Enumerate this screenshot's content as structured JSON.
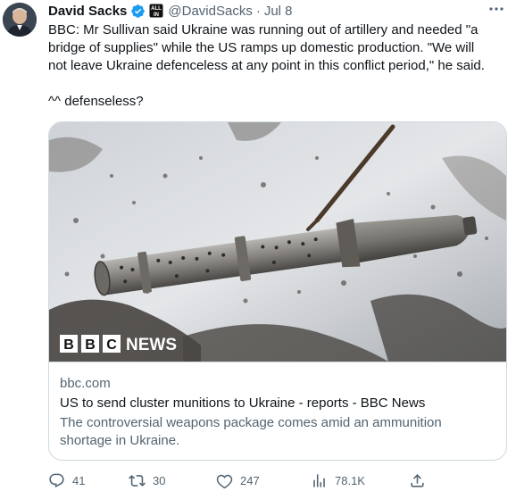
{
  "tweet": {
    "author_name": "David Sacks",
    "handle": "@DavidSacks",
    "separator": "·",
    "date": "Jul 8",
    "lines": [
      "BBC: Mr Sullivan said Ukraine was running out of artillery and needed \"a",
      "bridge of supplies\" while the US ramps up domestic production. \"We will",
      "not leave Ukraine defenceless at any point in this conflict period,\" he said."
    ],
    "comment": "^^ defenseless?"
  },
  "card": {
    "logo_text": "NEWS",
    "logo_letters": [
      "B",
      "B",
      "C"
    ],
    "domain": "bbc.com",
    "title": "US to send cluster munitions to Ukraine - reports - BBC News",
    "description_lines": [
      "The controversial weapons package comes amid an ammunition",
      "shortage in Ukraine."
    ]
  },
  "actions": {
    "replies": "41",
    "retweets": "30",
    "likes": "247",
    "views": "78.1K"
  },
  "colors": {
    "verified": "#1d9bf0",
    "text": "#0f1419",
    "secondary": "#536471",
    "border": "#cfd9de"
  },
  "icons": [
    "verified-badge-icon",
    "affiliate-badge-icon",
    "more-icon",
    "reply-icon",
    "retweet-icon",
    "like-icon",
    "views-icon",
    "share-icon"
  ]
}
